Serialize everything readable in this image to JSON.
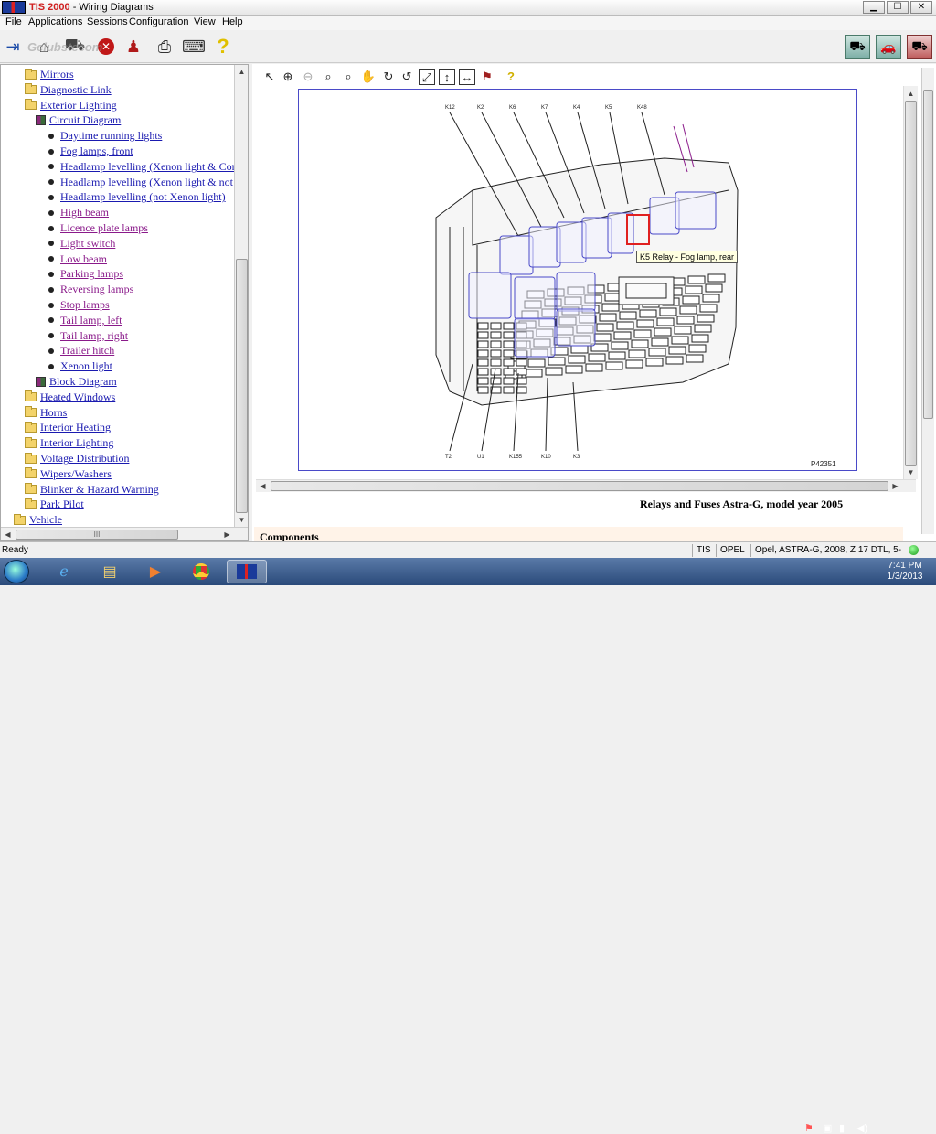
{
  "window": {
    "title_app": "TIS 2000",
    "title_sep": " - ",
    "title_module": "Wiring Diagrams",
    "min": "▁",
    "max": "☐",
    "close": "✕"
  },
  "menu": [
    "File",
    "Applications",
    "Sessions",
    "Configuration",
    "View",
    "Help"
  ],
  "watermark": "Gclubstecom",
  "tree": [
    {
      "label": "Mirrors",
      "type": "folder",
      "indent": 1,
      "visited": false
    },
    {
      "label": "Diagnostic Link",
      "type": "folder",
      "indent": 1,
      "visited": false
    },
    {
      "label": "Exterior Lighting",
      "type": "folder-open",
      "indent": 1,
      "visited": false
    },
    {
      "label": "Circuit Diagram",
      "type": "book",
      "indent": 2,
      "visited": false
    },
    {
      "label": "Daytime running lights",
      "type": "bullet",
      "indent": 3,
      "visited": false
    },
    {
      "label": "Fog lamps, front",
      "type": "bullet",
      "indent": 3,
      "visited": false
    },
    {
      "label": "Headlamp levelling (Xenon light & Con",
      "type": "bullet",
      "indent": 3,
      "visited": false
    },
    {
      "label": "Headlamp levelling (Xenon light & not (",
      "type": "bullet",
      "indent": 3,
      "visited": false
    },
    {
      "label": "Headlamp levelling (not Xenon light)",
      "type": "bullet",
      "indent": 3,
      "visited": false
    },
    {
      "label": "High beam",
      "type": "bullet",
      "indent": 3,
      "visited": true
    },
    {
      "label": "Licence plate lamps",
      "type": "bullet",
      "indent": 3,
      "visited": true
    },
    {
      "label": "Light switch",
      "type": "bullet",
      "indent": 3,
      "visited": true
    },
    {
      "label": "Low beam",
      "type": "bullet",
      "indent": 3,
      "visited": true
    },
    {
      "label": "Parking lamps",
      "type": "bullet",
      "indent": 3,
      "visited": true
    },
    {
      "label": "Reversing lamps",
      "type": "bullet",
      "indent": 3,
      "visited": true
    },
    {
      "label": "Stop lamps",
      "type": "bullet",
      "indent": 3,
      "visited": true
    },
    {
      "label": "Tail lamp, left",
      "type": "bullet",
      "indent": 3,
      "visited": true
    },
    {
      "label": "Tail lamp, right",
      "type": "bullet",
      "indent": 3,
      "visited": true
    },
    {
      "label": "Trailer hitch",
      "type": "bullet",
      "indent": 3,
      "visited": true
    },
    {
      "label": "Xenon light",
      "type": "bullet",
      "indent": 3,
      "visited": false
    },
    {
      "label": "Block Diagram",
      "type": "book",
      "indent": 2,
      "visited": false
    },
    {
      "label": "Heated Windows",
      "type": "folder",
      "indent": 1,
      "visited": false
    },
    {
      "label": "Horns",
      "type": "folder",
      "indent": 1,
      "visited": false
    },
    {
      "label": "Interior Heating",
      "type": "folder",
      "indent": 1,
      "visited": false
    },
    {
      "label": "Interior Lighting",
      "type": "folder",
      "indent": 1,
      "visited": false
    },
    {
      "label": "Voltage Distribution",
      "type": "folder",
      "indent": 1,
      "visited": false
    },
    {
      "label": "Wipers/Washers",
      "type": "folder",
      "indent": 1,
      "visited": false
    },
    {
      "label": "Blinker & Hazard Warning",
      "type": "folder",
      "indent": 1,
      "visited": false
    },
    {
      "label": "Park Pilot",
      "type": "folder",
      "indent": 1,
      "visited": false
    },
    {
      "label": "Vehicle",
      "type": "folder",
      "indent": 0,
      "visited": false
    }
  ],
  "diagram": {
    "top_labels": [
      "K12",
      "K2",
      "K6",
      "K7",
      "K4",
      "K5",
      "K48"
    ],
    "bottom_labels": [
      "T2",
      "U1",
      "K155",
      "K10",
      "K3"
    ],
    "figure_id": "P42351",
    "tooltip": "K5 Relay - Fog lamp, rear",
    "highlight_color": "#e02020",
    "outline_color": "#4a4ac8"
  },
  "caption": "Relays and Fuses Astra-G, model year 2005",
  "components_heading": "Components",
  "status": {
    "ready": "Ready",
    "cell1": "TIS",
    "cell2": "OPEL",
    "cell3": "Opel, ASTRA-G, 2008, Z 17 DTL, 5-MT"
  },
  "clock": {
    "time": "7:41 PM",
    "date": "1/3/2013"
  },
  "hscroll_grip": "III"
}
